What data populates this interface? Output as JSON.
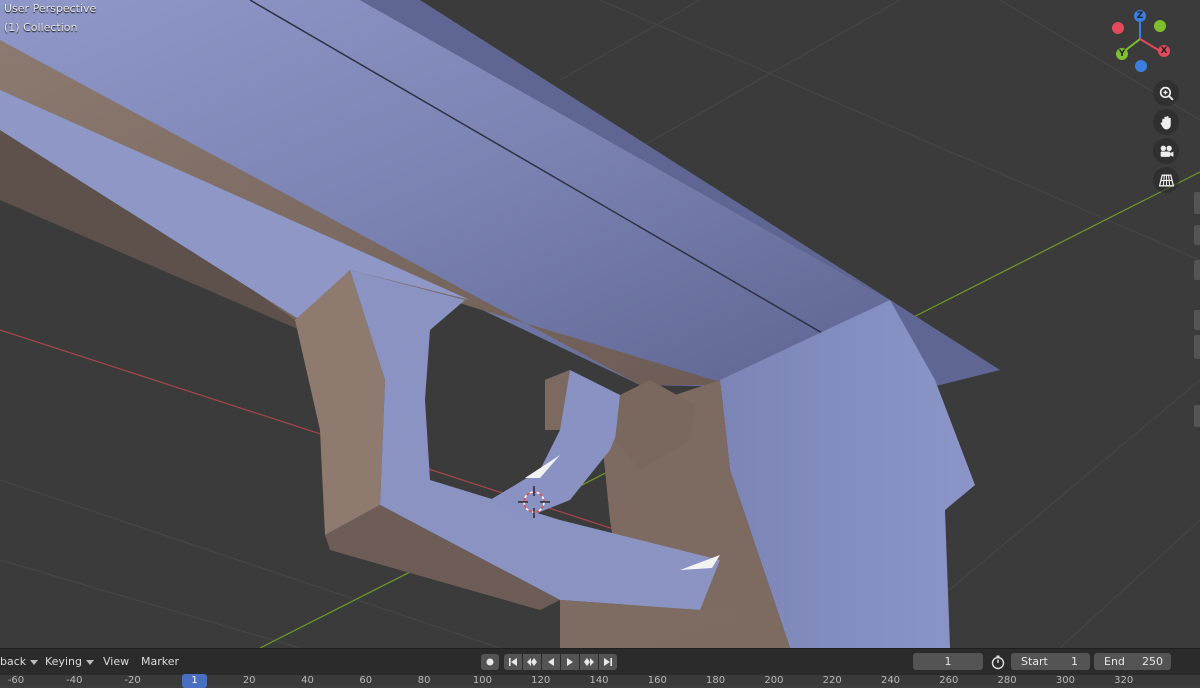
{
  "viewport": {
    "perspective_label": "User Perspective",
    "collection_label": "(1) Collection",
    "gizmo": {
      "z": "Z",
      "y": "Y",
      "x": "X"
    },
    "nav_icons": [
      "zoom-icon",
      "hand-pan-icon",
      "camera-icon",
      "grid-ortho-icon"
    ]
  },
  "timeline": {
    "playback_label": "back",
    "keying_label": "Keying",
    "view_label": "View",
    "marker_label": "Marker",
    "current_frame": "1",
    "start_label": "Start",
    "start_value": "1",
    "end_label": "End",
    "end_value": "250"
  },
  "ruler": {
    "ticks": [
      "-60",
      "-40",
      "-20",
      "1",
      "20",
      "40",
      "60",
      "80",
      "100",
      "120",
      "140",
      "160",
      "180",
      "200",
      "220",
      "240",
      "260",
      "280",
      "300",
      "320"
    ],
    "current": "1"
  },
  "colors": {
    "accent": "#4b6fc0",
    "axis_x": "#e04a5a",
    "axis_y": "#7fbf2e",
    "axis_z": "#3a7ee0"
  }
}
